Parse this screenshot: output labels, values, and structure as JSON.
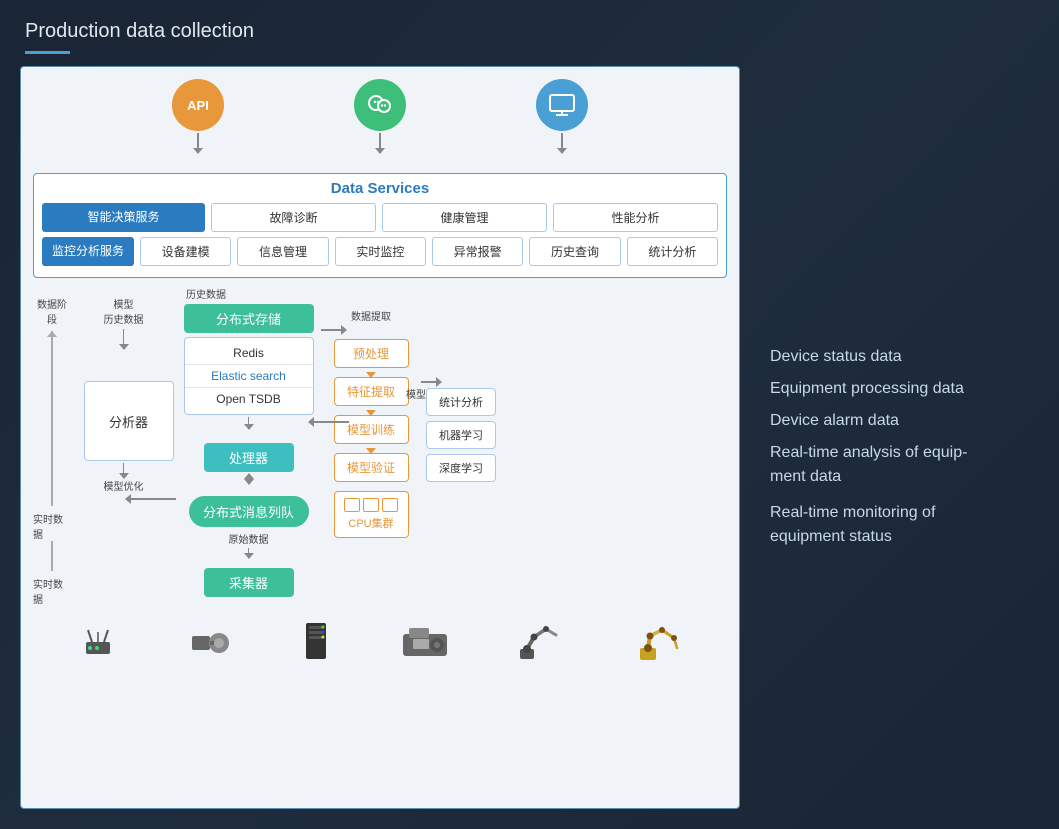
{
  "page": {
    "title": "Production data collection",
    "background": "#1a2535"
  },
  "diagram": {
    "top_icons": [
      {
        "label": "API",
        "type": "api",
        "symbol": "⟳"
      },
      {
        "label": "WeChat",
        "type": "wechat",
        "symbol": "∞"
      },
      {
        "label": "Monitor",
        "type": "monitor",
        "symbol": "⬛"
      }
    ],
    "data_services": {
      "title": "Data Services",
      "row1": [
        "智能决策服务",
        "故障诊断",
        "健康管理",
        "性能分析"
      ],
      "row2": [
        "监控分析服务",
        "设备建模",
        "信息管理",
        "实时监控",
        "异常报警",
        "历史查询",
        "统计分析"
      ]
    },
    "labels": {
      "data_stage": "数据阶段",
      "model_history": "模型\n历史数据",
      "model_optimize": "模型优化",
      "history_data": "历史数据",
      "data_extract": "数据提取",
      "model_store": "模型存储",
      "realtime_data1": "实时数据",
      "realtime_data2": "实时数据",
      "original_data": "原始数据"
    },
    "storage": {
      "title": "分布式存储",
      "items": [
        "Redis",
        "Elastic search",
        "Open TSDB"
      ]
    },
    "analyzer": "分析器",
    "processor": "处理器",
    "message_queue": "分布式消息列队",
    "collector": "采集器",
    "pipeline": [
      "预处理",
      "特征提取",
      "模型训练",
      "模型验证"
    ],
    "cpu_cluster": "CPU集群",
    "results": [
      "统计分析",
      "机器学习",
      "深度学习"
    ]
  },
  "info_panel": {
    "items": [
      "Device status data",
      "Equipment processing data",
      "Device alarm data",
      "Real-time analysis of equip-\nment data",
      "Real-time monitoring of\nequipment status"
    ]
  }
}
